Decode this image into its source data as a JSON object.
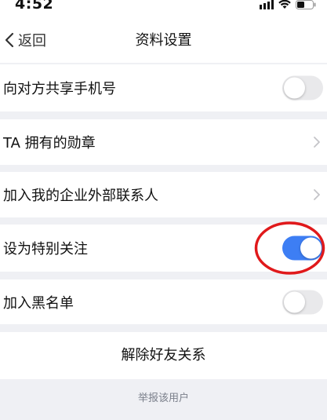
{
  "status_bar": {
    "time": "4:52"
  },
  "nav": {
    "back_label": "返回",
    "title": "资料设置"
  },
  "settings": [
    {
      "label": "向对方共享手机号",
      "control": "toggle",
      "on": false
    },
    {
      "label": "TA 拥有的勋章",
      "control": "chevron"
    },
    {
      "label": "加入我的企业外部联系人",
      "control": "chevron"
    },
    {
      "label": "设为特别关注",
      "control": "toggle",
      "on": true
    },
    {
      "label": "加入黑名单",
      "control": "toggle",
      "on": false
    }
  ],
  "remove_friend_label": "解除好友关系",
  "report_label": "举报该用户",
  "colors": {
    "page_background": "#eff0f4",
    "toggle_on": "#3d7ef4",
    "annotation_circle": "#e0191b"
  }
}
